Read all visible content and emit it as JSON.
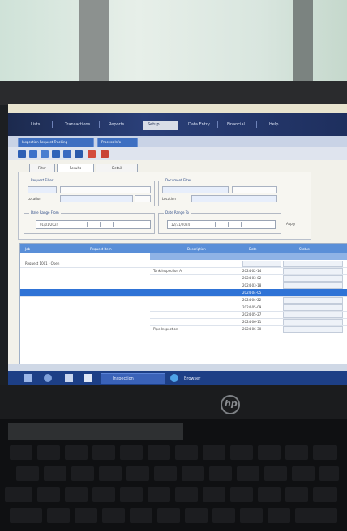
{
  "menubar": {
    "items": [
      "Lists",
      "Transactions",
      "Reports",
      "Setup",
      "Data Entry",
      "Financial",
      "Help"
    ]
  },
  "tabstrip": {
    "tabs": [
      "Inspection Request Tracking",
      "Process Info"
    ]
  },
  "subtabs": [
    "Filter",
    "Results",
    "Detail"
  ],
  "filter": {
    "group_left_title": "Request Filter",
    "group_right_title": "Document Filter",
    "group_date_left_title": "Date Range From",
    "group_date_right_title": "Date Range To",
    "field_left_label": "Location",
    "field_right_label": "Location",
    "date_from_value": "01/01/2024",
    "date_to_value": "12/31/2024",
    "apply_label": "Apply"
  },
  "grid": {
    "columns": [
      "Job",
      "Request Item",
      "Description",
      "Date",
      "Status"
    ],
    "first_row_label": "Request 1001 - Open",
    "row2_label": "Tank Inspection A",
    "row_last_label": "Pipe Inspection",
    "date_cells": [
      "2024-02-14",
      "2024-03-02",
      "2024-03-18",
      "2024-04-05",
      "2024-04-22",
      "2024-05-09",
      "2024-05-27",
      "2024-06-11",
      "2024-06-30"
    ]
  },
  "taskbar": {
    "apps": [
      "Inspection",
      "Browser"
    ]
  },
  "colors": {
    "menubar": "#1e2f5e",
    "grid_header": "#5a8fd8",
    "selected_row": "#2f73d6",
    "taskbar": "#1d3f86"
  },
  "icons": [
    "start-icon",
    "search-icon",
    "file-explorer-icon",
    "app-icon",
    "browser-icon",
    "hp-logo"
  ]
}
